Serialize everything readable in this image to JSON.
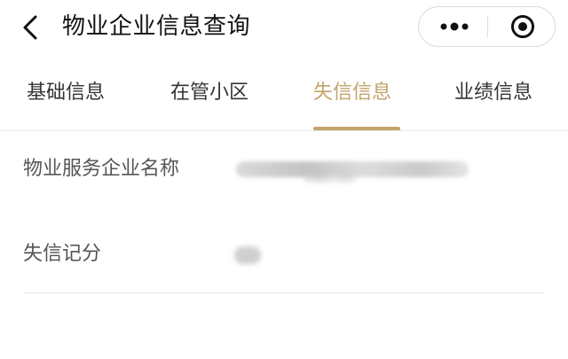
{
  "navbar": {
    "title": "物业企业信息查询",
    "back_icon": "chevron-left-icon",
    "more_icon": "more-dots-icon",
    "close_icon": "target-close-icon"
  },
  "tabs": [
    {
      "label": "基础信息",
      "active": false
    },
    {
      "label": "在管小区",
      "active": false
    },
    {
      "label": "失信信息",
      "active": true
    },
    {
      "label": "业绩信息",
      "active": false
    }
  ],
  "colors": {
    "accent": "#c3a46a",
    "text_primary": "#111111",
    "text_secondary": "#555555",
    "divider": "#e6e6e6"
  },
  "fields": [
    {
      "label": "物业服务企业名称"
    },
    {
      "label": "失信记分"
    }
  ]
}
